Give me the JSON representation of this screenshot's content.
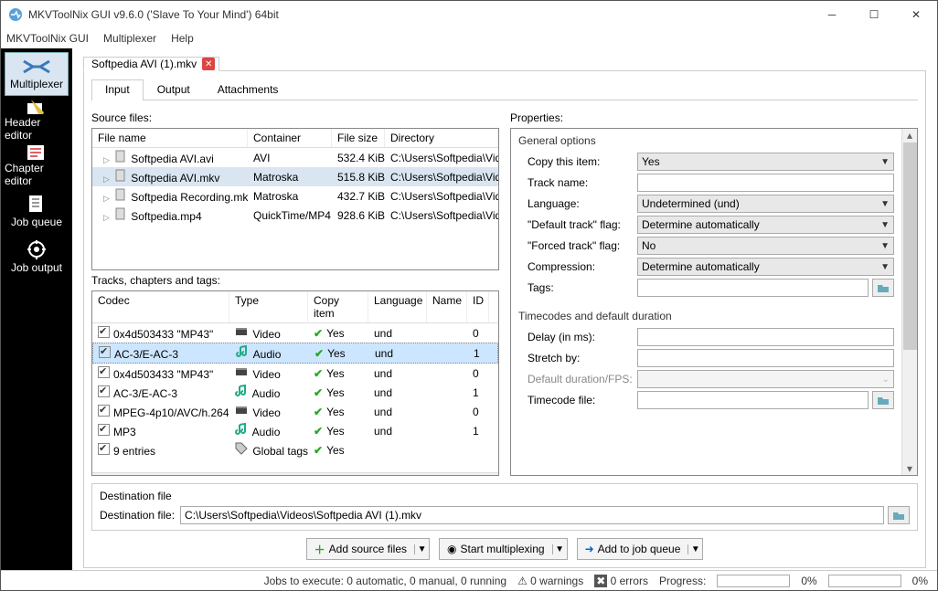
{
  "window": {
    "title": "MKVToolNix GUI v9.6.0 ('Slave To Your Mind') 64bit"
  },
  "menubar": [
    "MKVToolNix GUI",
    "Multiplexer",
    "Help"
  ],
  "sidebar": [
    {
      "label": "Multiplexer",
      "active": true
    },
    {
      "label": "Header editor"
    },
    {
      "label": "Chapter editor"
    },
    {
      "label": "Job queue"
    },
    {
      "label": "Job output"
    }
  ],
  "doc_tab": "Softpedia AVI (1).mkv",
  "tabs": {
    "input": "Input",
    "output": "Output",
    "attachments": "Attachments"
  },
  "labels": {
    "source_files": "Source files:",
    "tracks": "Tracks, chapters and tags:",
    "properties": "Properties:",
    "general": "General options",
    "timecodes": "Timecodes and default duration",
    "dest_group": "Destination file",
    "dest_file": "Destination file:"
  },
  "source_headers": {
    "file": "File name",
    "container": "Container",
    "size": "File size",
    "dir": "Directory"
  },
  "source_files": [
    {
      "name": "Softpedia AVI.avi",
      "container": "AVI",
      "size": "532.4 KiB",
      "dir": "C:\\Users\\Softpedia\\Videos"
    },
    {
      "name": "Softpedia AVI.mkv",
      "container": "Matroska",
      "size": "515.8 KiB",
      "dir": "C:\\Users\\Softpedia\\Videos",
      "sel": true
    },
    {
      "name": "Softpedia Recording.mkv",
      "container": "Matroska",
      "size": "432.7 KiB",
      "dir": "C:\\Users\\Softpedia\\Videos"
    },
    {
      "name": "Softpedia.mp4",
      "container": "QuickTime/MP4",
      "size": "928.6 KiB",
      "dir": "C:\\Users\\Softpedia\\Videos"
    }
  ],
  "track_headers": {
    "codec": "Codec",
    "type": "Type",
    "copy": "Copy item",
    "lang": "Language",
    "name": "Name",
    "id": "ID"
  },
  "tracks": [
    {
      "codec": "0x4d503433 \"MP43\"",
      "type": "Video",
      "copy": "Yes",
      "lang": "und",
      "name": "",
      "id": "0"
    },
    {
      "codec": "AC-3/E-AC-3",
      "type": "Audio",
      "copy": "Yes",
      "lang": "und",
      "name": "",
      "id": "1",
      "sel": true
    },
    {
      "codec": "0x4d503433 \"MP43\"",
      "type": "Video",
      "copy": "Yes",
      "lang": "und",
      "name": "",
      "id": "0"
    },
    {
      "codec": "AC-3/E-AC-3",
      "type": "Audio",
      "copy": "Yes",
      "lang": "und",
      "name": "",
      "id": "1"
    },
    {
      "codec": "MPEG-4p10/AVC/h.264",
      "type": "Video",
      "copy": "Yes",
      "lang": "und",
      "name": "",
      "id": "0"
    },
    {
      "codec": "MP3",
      "type": "Audio",
      "copy": "Yes",
      "lang": "und",
      "name": "",
      "id": "1"
    },
    {
      "codec": "9 entries",
      "type": "Global tags",
      "copy": "Yes",
      "lang": "",
      "name": "",
      "id": "",
      "tags": true
    }
  ],
  "props": {
    "copy_item": {
      "label": "Copy this item:",
      "value": "Yes"
    },
    "track_name": {
      "label": "Track name:",
      "value": ""
    },
    "language": {
      "label": "Language:",
      "value": "Undetermined (und)"
    },
    "default_track": {
      "label": "\"Default track\" flag:",
      "value": "Determine automatically"
    },
    "forced_track": {
      "label": "\"Forced track\" flag:",
      "value": "No"
    },
    "compression": {
      "label": "Compression:",
      "value": "Determine automatically"
    },
    "tags": {
      "label": "Tags:",
      "value": ""
    },
    "delay": {
      "label": "Delay (in ms):",
      "value": ""
    },
    "stretch": {
      "label": "Stretch by:",
      "value": ""
    },
    "duration": {
      "label": "Default duration/FPS:",
      "value": ""
    },
    "timecode_file": {
      "label": "Timecode file:",
      "value": ""
    }
  },
  "dest_value": "C:\\Users\\Softpedia\\Videos\\Softpedia AVI (1).mkv",
  "buttons": {
    "add": "Add source files",
    "start": "Start multiplexing",
    "queue": "Add to job queue"
  },
  "status": {
    "jobs": "Jobs to execute:  0 automatic, 0 manual, 0 running",
    "warnings": "0 warnings",
    "errors": "0 errors",
    "progress": "Progress:",
    "p1": "0%",
    "p2": "0%"
  }
}
